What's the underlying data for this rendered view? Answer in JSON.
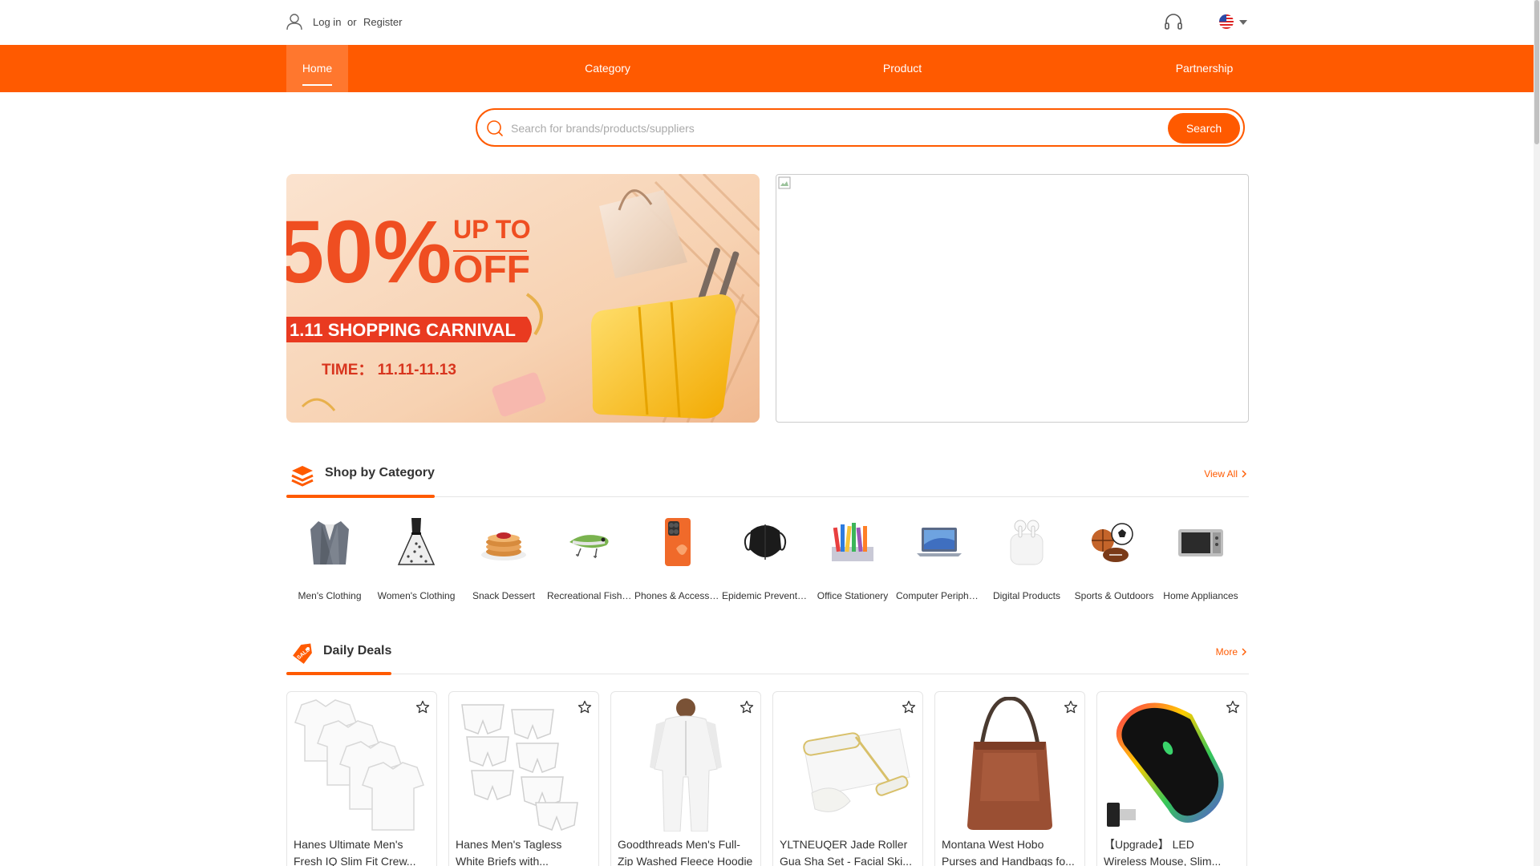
{
  "header": {
    "login_label": "Log in",
    "or_label": "or",
    "register_label": "Register",
    "support_icon": "headset-icon",
    "language_flag": "us-flag"
  },
  "nav": {
    "items": [
      {
        "label": "Home",
        "active": true
      },
      {
        "label": "Category"
      },
      {
        "label": "Product"
      },
      {
        "label": "Partnership"
      }
    ]
  },
  "search": {
    "placeholder": "Search for brands/products/suppliers",
    "value": "",
    "button_label": "Search"
  },
  "banner": {
    "headline_pct": "50%",
    "up_to": "UP TO",
    "off": "OFF",
    "event": "1.11 SHOPPING CARNIVAL",
    "time": "TIME： 11.11-11.13"
  },
  "shop_by_category": {
    "title": "Shop by Category",
    "view_all_label": "View All",
    "items": [
      {
        "label": "Men's Clothing"
      },
      {
        "label": "Women's Clothing"
      },
      {
        "label": "Snack Dessert"
      },
      {
        "label": "Recreational Fishing"
      },
      {
        "label": "Phones & Accessories"
      },
      {
        "label": "Epidemic Prevention"
      },
      {
        "label": "Office Stationery"
      },
      {
        "label": "Computer Peripherals"
      },
      {
        "label": "Digital Products"
      },
      {
        "label": "Sports & Outdoors"
      },
      {
        "label": "Home Appliances"
      }
    ]
  },
  "daily_deals": {
    "title": "Daily Deals",
    "more_label": "More",
    "items": [
      {
        "line1": "Hanes Ultimate Men's",
        "line2": "Fresh IQ Slim Fit Crew..."
      },
      {
        "line1": "Hanes Men's Tagless",
        "line2": "White Briefs with..."
      },
      {
        "line1": "Goodthreads Men's Full-",
        "line2": "Zip Washed Fleece Hoodie"
      },
      {
        "line1": "YLTNEUQER Jade Roller",
        "line2": "Gua Sha Set - Facial Ski..."
      },
      {
        "line1": "Montana West Hobo",
        "line2": "Purses and Handbags fo..."
      },
      {
        "line1": "【Upgrade】 LED",
        "line2": "Wireless Mouse, Slim..."
      }
    ]
  },
  "colors": {
    "brand": "#ff5a00"
  }
}
